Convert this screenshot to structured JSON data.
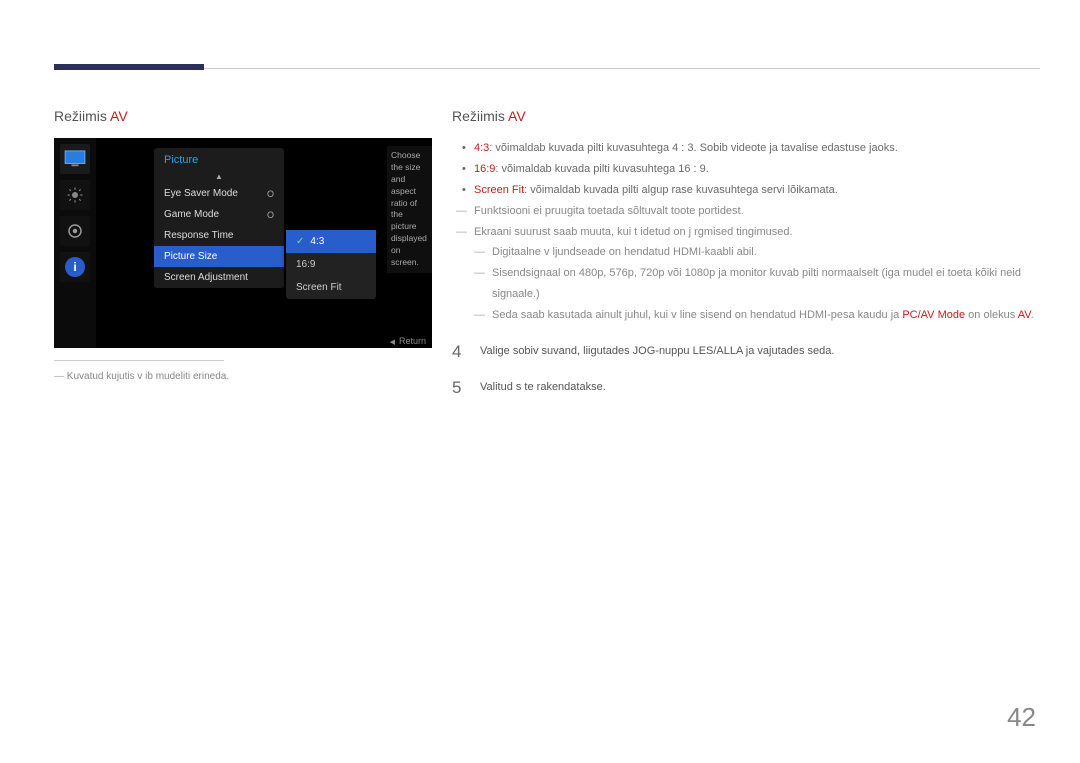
{
  "page_number": "42",
  "left": {
    "heading_text": "Režiimis ",
    "heading_av": "AV",
    "caption": "Kuvatud kujutis v ib mudeliti erineda."
  },
  "right": {
    "heading_text": "Režiimis ",
    "heading_av": "AV",
    "b1_label": "4:3",
    "b1_text": ": võimaldab kuvada pilti kuvasuhtega 4 : 3. Sobib videote ja tavalise edastuse jaoks.",
    "b2_label": "16:9",
    "b2_text": ": võimaldab kuvada pilti kuvasuhtega 16 : 9.",
    "b3_label": "Screen Fit",
    "b3_text": ": võimaldab kuvada pilti algup rase kuvasuhtega servi lõikamata.",
    "d1": "Funktsiooni ei pruugita toetada sõltuvalt toote portidest.",
    "d2": "Ekraani suurust saab muuta, kui t idetud on j rgmised tingimused.",
    "d2a": "Digitaalne v ljundseade on  hendatud HDMI-kaabli abil.",
    "d2b": "Sisendsignaal on 480p, 576p, 720p või 1080p ja monitor kuvab pilti normaalselt (iga mudel ei toeta kõiki neid signaale.)",
    "d2c_pre": "Seda saab kasutada ainult juhul, kui v line sisend on  hendatud HDMI-pesa kaudu ja ",
    "d2c_hl1": "PC/AV Mode",
    "d2c_mid": " on olekus ",
    "d2c_hl2": "AV",
    "d2c_post": ".",
    "step4_num": "4",
    "step4_text": "Valige sobiv suvand, liigutades JOG-nuppu  LES/ALLA ja vajutades seda.",
    "step5_num": "5",
    "step5_text": "Valitud s te rakendatakse."
  },
  "osd": {
    "title": "Picture",
    "r1": "Eye Saver Mode",
    "v1": "O",
    "r2": "Game Mode",
    "v2": "O",
    "r3": "Response Time",
    "r4": "Picture Size",
    "r5": "Screen Adjustment",
    "sub1": "4:3",
    "sub2": "16:9",
    "sub3": "Screen Fit",
    "desc": "Choose the size and aspect ratio of the picture displayed on screen.",
    "return": "Return",
    "info_i": "i"
  }
}
